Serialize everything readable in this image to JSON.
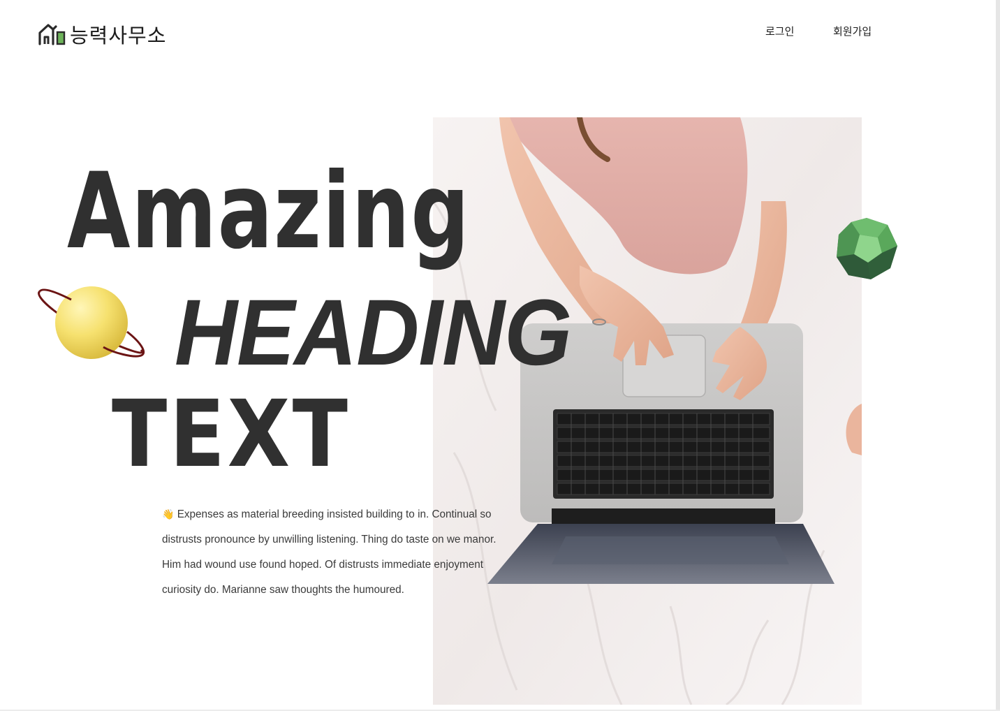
{
  "header": {
    "logo_text": "능력사무소",
    "logo_icon": "house-icon",
    "nav": {
      "login": "로그인",
      "signup": "회원가입"
    }
  },
  "hero": {
    "line1": "Amazing",
    "line2": "HEADING",
    "line3": "TEXT",
    "decorations": {
      "left": "planet-icon",
      "right": "gem-icon"
    },
    "body_emoji": "👋",
    "body_text": "Expenses as material breeding insisted building to in. Continual so distrusts pronounce by unwilling listening. Thing do taste on we manor. Him had wound use found hoped. Of distrusts immediate enjoyment curiosity do. Marianne saw thoughts the humoured.",
    "image": "person-typing-on-laptop-photo"
  },
  "colors": {
    "text": "#303030",
    "logo_accent": "#6db35a",
    "planet": "#f2dd62",
    "planet_ring": "#6b1414",
    "gem": "#4f9a55"
  }
}
